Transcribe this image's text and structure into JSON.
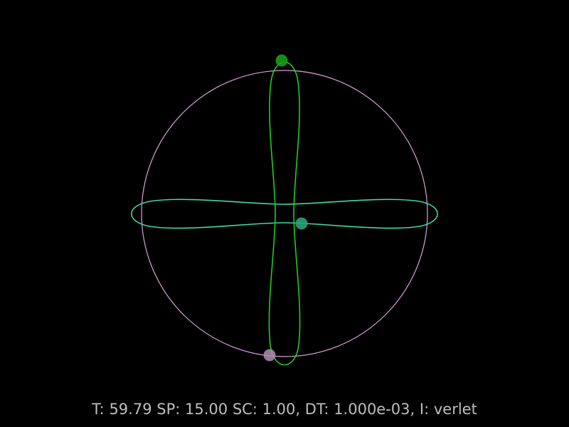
{
  "status": {
    "time_label": "T:",
    "time_value": "59.79",
    "speed_label": "SP:",
    "speed_value": "15.00",
    "scale_label": "SC:",
    "scale_value": "1.00,",
    "dt_label": "DT:",
    "dt_value": "1.000e-03,",
    "integrator_label": "I:",
    "integrator_value": "verlet"
  },
  "colors": {
    "background": "#000000",
    "text": "#bebebe",
    "orbit_circle": "#dda0dd",
    "orbit_vertical": "#22cc22",
    "orbit_horizontal": "#40d9a0",
    "body_violet": "#b08cb0",
    "body_green": "#1a9c1a",
    "body_teal": "#2aa27a"
  },
  "bodies": [
    {
      "name": "body-violet",
      "color_key": "body_violet"
    },
    {
      "name": "body-green",
      "color_key": "body_green"
    },
    {
      "name": "body-teal",
      "color_key": "body_teal"
    }
  ]
}
